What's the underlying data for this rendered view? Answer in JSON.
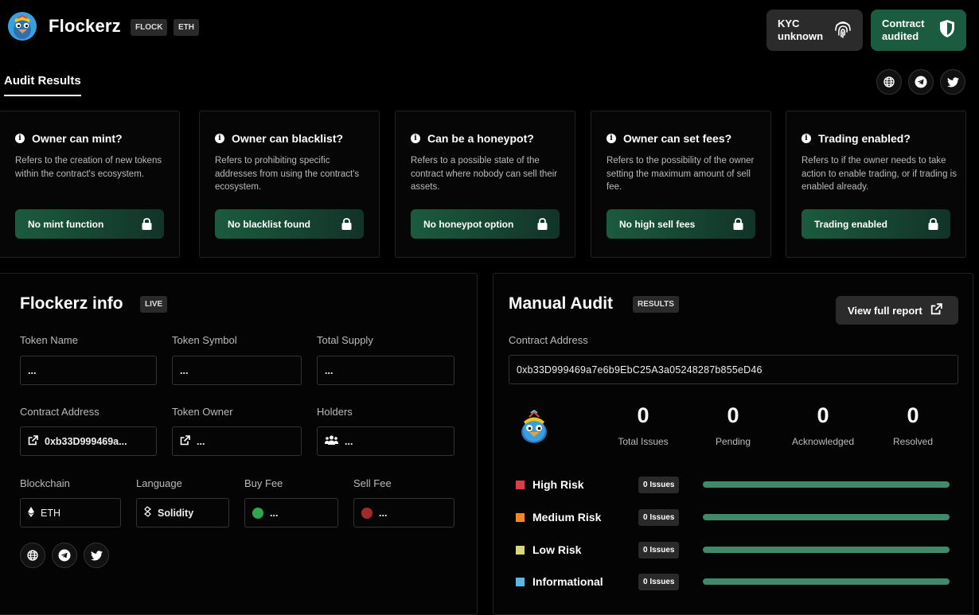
{
  "header": {
    "brand": "Flockerz",
    "tags": [
      "FLOCK",
      "ETH"
    ],
    "kyc": {
      "line1": "KYC",
      "line2": "unknown",
      "icon": "fingerprint-icon"
    },
    "contract": {
      "line1": "Contract",
      "line2": "audited",
      "icon": "shield-check-icon"
    }
  },
  "tab": {
    "title": "Audit Results"
  },
  "social": [
    "globe-icon",
    "telegram-icon",
    "twitter-icon"
  ],
  "checks": [
    {
      "question": "Owner can mint?",
      "desc": "Refers to the creation of new tokens within the contract's ecosystem.",
      "result": "No mint function"
    },
    {
      "question": "Owner can blacklist?",
      "desc": "Refers to prohibiting specific addresses from using the contract's ecosystem.",
      "result": "No blacklist found"
    },
    {
      "question": "Can be a honeypot?",
      "desc": "Refers to a possible state of the contract where nobody can sell their assets.",
      "result": "No honeypot option"
    },
    {
      "question": "Owner can set fees?",
      "desc": "Refers to the possibility of the owner setting the maximum amount of sell fee.",
      "result": "No high sell fees"
    },
    {
      "question": "Trading enabled?",
      "desc": "Refers to if the owner needs to take action to enable trading, or if trading is enabled already.",
      "result": "Trading enabled"
    }
  ],
  "info": {
    "title": "Flockerz info",
    "badge": "LIVE",
    "fields": {
      "token_name": {
        "label": "Token Name",
        "value": "..."
      },
      "token_symbol": {
        "label": "Token Symbol",
        "value": "..."
      },
      "total_supply": {
        "label": "Total Supply",
        "value": "..."
      },
      "contract_address": {
        "label": "Contract Address",
        "value": "0xb33D999469a..."
      },
      "token_owner": {
        "label": "Token Owner",
        "value": "..."
      },
      "holders": {
        "label": "Holders",
        "value": "..."
      },
      "blockchain": {
        "label": "Blockchain",
        "value": "ETH"
      },
      "language": {
        "label": "Language",
        "value": "Solidity"
      },
      "buy_fee": {
        "label": "Buy Fee",
        "value": "..."
      },
      "sell_fee": {
        "label": "Sell Fee",
        "value": "..."
      }
    }
  },
  "manual": {
    "title": "Manual Audit",
    "badge": "RESULTS",
    "button": "View full report",
    "address_label": "Contract Address",
    "address": "0xb33D999469a7e6b9EbC25A3a05248287b855eD46",
    "stats": [
      {
        "value": "0",
        "label": "Total Issues"
      },
      {
        "value": "0",
        "label": "Pending"
      },
      {
        "value": "0",
        "label": "Acknowledged"
      },
      {
        "value": "0",
        "label": "Resolved"
      }
    ],
    "risks": [
      {
        "name": "High Risk",
        "issues": "0 Issues",
        "color": "#d9404a"
      },
      {
        "name": "Medium Risk",
        "issues": "0 Issues",
        "color": "#f08a24"
      },
      {
        "name": "Low Risk",
        "issues": "0 Issues",
        "color": "#d8d77a"
      },
      {
        "name": "Informational",
        "issues": "0 Issues",
        "color": "#5bb8e0"
      }
    ]
  },
  "colors": {
    "accent_green": "#1b5b3f",
    "buy_fee_dot": "#2ea84f",
    "sell_fee_dot": "#a32a2a"
  }
}
